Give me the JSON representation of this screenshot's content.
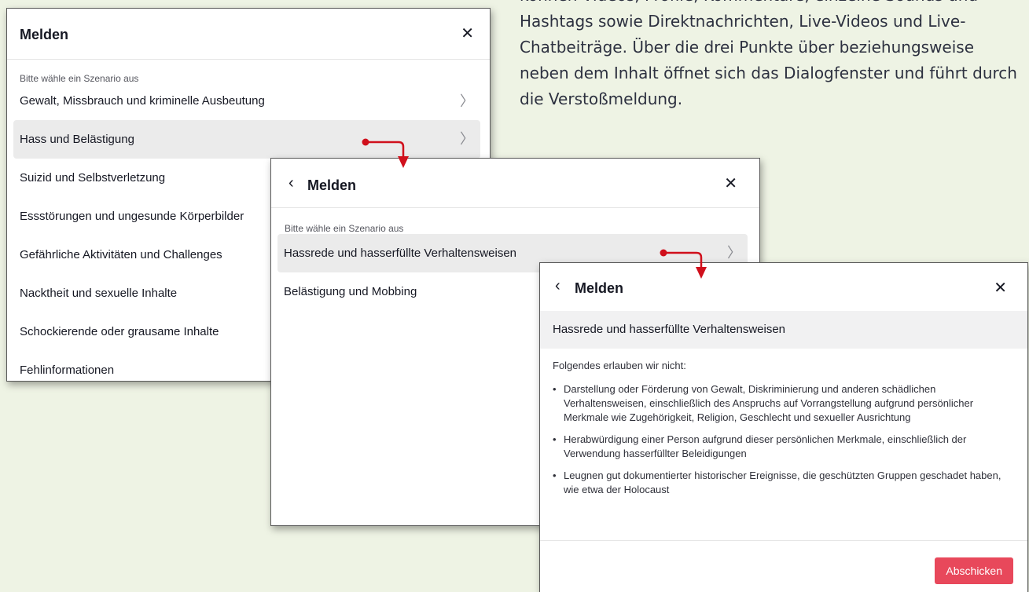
{
  "background_text": "können Videos, Profile, Kommentare, einzelne Sounds und Hashtags sowie Direktnachrichten, Live-Videos und Live-Chatbeiträge. Über die drei Punkte über beziehungsweise neben dem Inhalt öffnet sich das Dialogfenster und führt durch die Verstoßmeldung.",
  "colors": {
    "accent": "#e8485b",
    "arrow": "#d0101c",
    "highlight": "#ebebeb"
  },
  "icons": {
    "close": "close-icon",
    "back": "chevron-left-icon",
    "next": "chevron-right-icon"
  },
  "dialog1": {
    "title": "Melden",
    "subtitle": "Bitte wähle ein Szenario aus",
    "items": [
      "Gewalt, Missbrauch und kriminelle Ausbeutung",
      "Hass und Belästigung",
      "Suizid und Selbstverletzung",
      "Essstörungen und ungesunde Körperbilder",
      "Gefährliche Aktivitäten und Challenges",
      "Nacktheit und sexuelle Inhalte",
      "Schockierende oder grausame Inhalte",
      "Fehlinformationen"
    ]
  },
  "dialog2": {
    "title": "Melden",
    "subtitle": "Bitte wähle ein Szenario aus",
    "items": [
      "Hassrede und hasserfüllte Verhaltensweisen",
      "Belästigung und Mobbing"
    ]
  },
  "dialog3": {
    "title": "Melden",
    "section_title": "Hassrede und hasserfüllte Verhaltensweisen",
    "intro": "Folgendes erlauben wir nicht:",
    "bullets": [
      "Darstellung oder Förderung von Gewalt, Diskriminierung und anderen schädlichen Verhaltensweisen, einschließlich des Anspruchs auf Vorrangstellung aufgrund persönlicher Merkmale wie Zugehörigkeit, Religion, Geschlecht und sexueller Ausrichtung",
      "Herabwürdigung einer Person aufgrund dieser persönlichen Merkmale, einschließlich der Verwendung hasserfüllter Beleidigungen",
      "Leugnen gut dokumentierter historischer Ereignisse, die geschützten Gruppen geschadet haben, wie etwa der Holocaust"
    ],
    "submit_label": "Abschicken"
  }
}
